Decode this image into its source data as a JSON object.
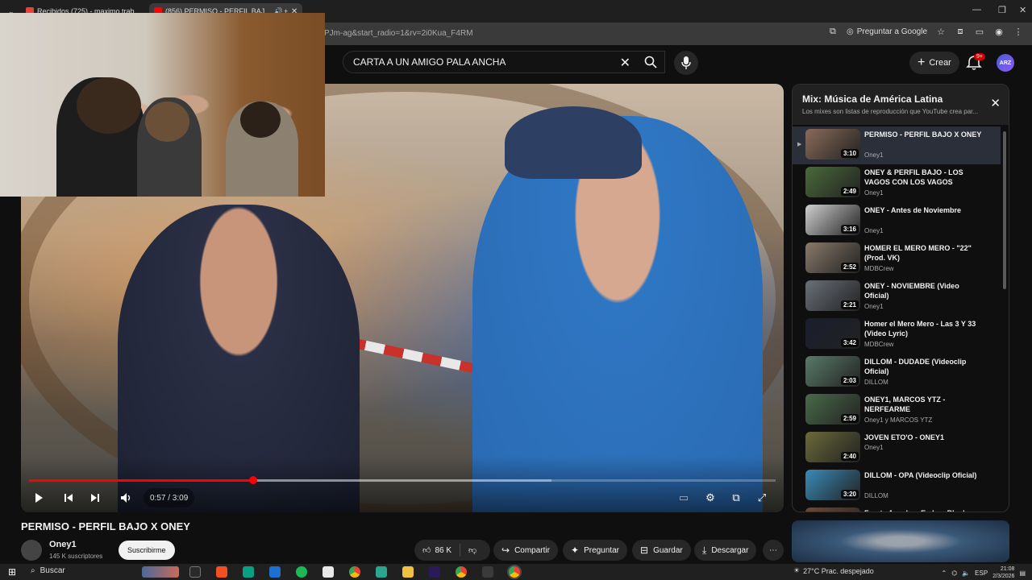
{
  "browser": {
    "tabs": [
      {
        "title": "Recibidos (725) - maximo.trab..."
      },
      {
        "title": "(856) PERMISO - PERFIL BAJ..."
      }
    ],
    "url": "PJm-ag&start_radio=1&rv=2i0Kua_F4RM",
    "ask_google": "Preguntar a Google"
  },
  "header": {
    "search_value": "CARTA A UN AMIGO PALA ANCHA",
    "create_label": "Crear",
    "notification_badge": "9+",
    "avatar_text": "ARZ"
  },
  "player": {
    "time": "0:57 / 3:09",
    "progress_fraction": 0.3,
    "buffered_fraction": 0.7
  },
  "video": {
    "title": "PERMISO - PERFIL BAJO X ONEY",
    "channel": "Oney1",
    "subscribers": "145 K suscriptores",
    "subscribe_label": "Suscribirme",
    "likes": "86 K",
    "share_label": "Compartir",
    "ask_label": "Preguntar",
    "save_label": "Guardar",
    "download_label": "Descargar"
  },
  "playlist": {
    "title": "Mix: Música de América Latina",
    "subtitle": "Los mixes son listas de reproducción que YouTube crea par...",
    "items": [
      {
        "title": "PERMISO - PERFIL BAJO X ONEY",
        "channel": "Oney1",
        "duration": "3:10",
        "color": "#8a6b5a"
      },
      {
        "title": "ONEY & PERFIL BAJO - LOS VAGOS CON LOS VAGOS",
        "channel": "Oney1",
        "duration": "2:49",
        "color": "#4a6a3a"
      },
      {
        "title": "ONEY - Antes de Noviembre",
        "channel": "Oney1",
        "duration": "3:16",
        "color": "#cfcfcf"
      },
      {
        "title": "HOMER EL MERO MERO - \"22\" (Prod. VK)",
        "channel": "MDBCrew",
        "duration": "2:52",
        "color": "#8a7a6a"
      },
      {
        "title": "ONEY - NOVIEMBRE (Video Oficial)",
        "channel": "Oney1",
        "duration": "2:21",
        "color": "#6a7078"
      },
      {
        "title": "Homer el Mero Mero - Las 3 Y 33 (Video Lyric)",
        "channel": "MDBCrew",
        "duration": "3:42",
        "color": "#1a1e2e"
      },
      {
        "title": "DILLOM - DUDADE (Videoclip Oficial)",
        "channel": "DILLOM",
        "duration": "2:03",
        "color": "#5a7a6a"
      },
      {
        "title": "ONEY1, MARCOS YTZ - NERFEARME",
        "channel": "Oney1 y MARCOS YTZ",
        "duration": "2:59",
        "color": "#4a6a4a"
      },
      {
        "title": "JOVEN ETO'O - ONEY1",
        "channel": "Oney1",
        "duration": "2:40",
        "color": "#6a6a3a"
      },
      {
        "title": "DILLOM - OPA (Videoclip Oficial)",
        "channel": "DILLOM",
        "duration": "3:20",
        "color": "#3a8ab8"
      },
      {
        "title": "Fuerte Apache - En Los Blocks",
        "channel": "",
        "duration": "",
        "color": "#6a4a3a"
      }
    ]
  },
  "taskbar": {
    "search_label": "Buscar",
    "weather": "27°C  Prac. despejado",
    "lang": "ESP",
    "time": "21:08",
    "date": "2/3/2026"
  }
}
